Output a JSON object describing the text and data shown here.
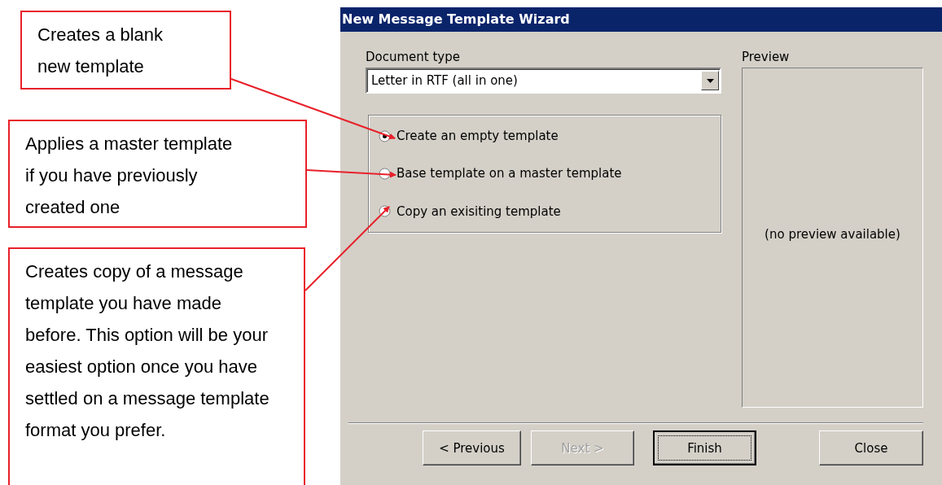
{
  "annotations": [
    {
      "text": "Creates a blank new template"
    },
    {
      "text": "Applies a master template if you have previously created one"
    },
    {
      "text": "Creates copy of a message template you have made before.  This option will be your easiest option once you have settled on a message template format you prefer."
    }
  ],
  "window": {
    "title": "New Message Template Wizard"
  },
  "document_type": {
    "label": "Document type",
    "value": "Letter in RTF (all in one)"
  },
  "template_options": [
    {
      "label": "Create an empty template",
      "selected": true
    },
    {
      "label": "Base template on a master template",
      "selected": false
    },
    {
      "label": "Copy an exisiting  template",
      "selected": false
    }
  ],
  "preview": {
    "label": "Preview",
    "message": "(no preview available)"
  },
  "buttons": [
    {
      "label": "< Previous",
      "disabled": false,
      "default": false
    },
    {
      "label": "Next >",
      "disabled": true,
      "default": false
    },
    {
      "label": "Finish",
      "disabled": false,
      "default": true
    },
    {
      "label": "Close",
      "disabled": false,
      "default": false
    }
  ]
}
